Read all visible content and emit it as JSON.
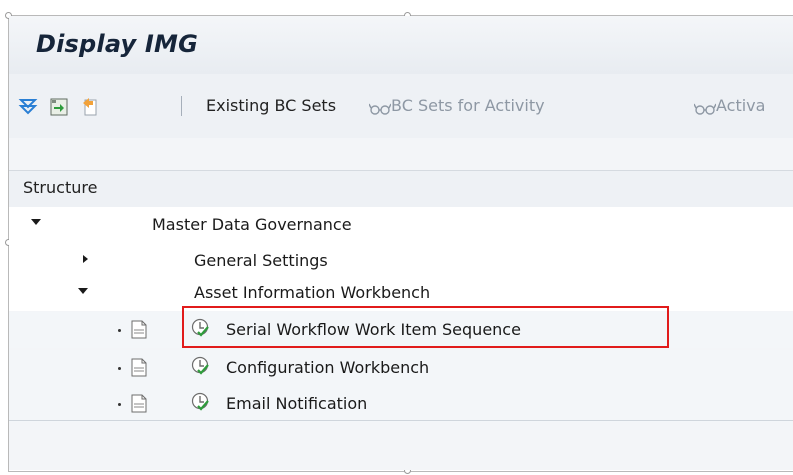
{
  "window": {
    "title": "Display IMG"
  },
  "toolbar": {
    "icons": [
      "filter-down-icon",
      "execute-icon",
      "bookmark-icon"
    ],
    "existing_bc_sets": "Existing BC Sets",
    "bc_sets_for_activity": "BC Sets for Activity",
    "activation_truncated": "Activa"
  },
  "structure": {
    "header": "Structure"
  },
  "tree": {
    "root": "Master Data Governance",
    "general_settings": "General Settings",
    "asset_info_workbench": "Asset Information Workbench",
    "items": [
      {
        "label": "Serial Workflow Work Item Sequence",
        "highlighted": true
      },
      {
        "label": "Configuration Workbench",
        "highlighted": false
      },
      {
        "label": "Email Notification",
        "highlighted": false
      }
    ]
  },
  "colors": {
    "highlight": "#e11b1b",
    "title": "#16253a",
    "accent_green": "#2e9c3c"
  }
}
